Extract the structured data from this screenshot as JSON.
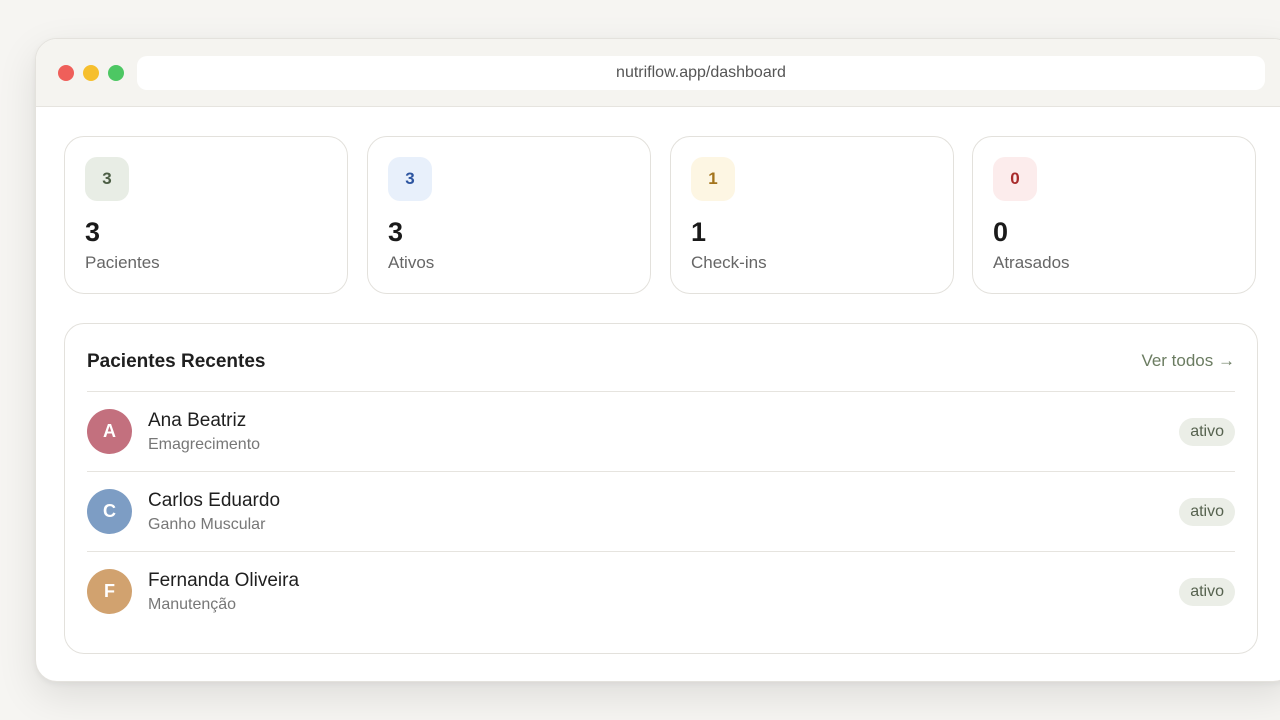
{
  "browser": {
    "url": "nutriflow.app/dashboard"
  },
  "stats": [
    {
      "badge": "3",
      "value": "3",
      "label": "Pacientes",
      "badge_bg": "#e8ede5",
      "badge_color": "#4b5d44"
    },
    {
      "badge": "3",
      "value": "3",
      "label": "Ativos",
      "badge_bg": "#e8f0fb",
      "badge_color": "#2d55a0"
    },
    {
      "badge": "1",
      "value": "1",
      "label": "Check-ins",
      "badge_bg": "#fdf6e3",
      "badge_color": "#a3741c"
    },
    {
      "badge": "0",
      "value": "0",
      "label": "Atrasados",
      "badge_bg": "#fcecec",
      "badge_color": "#a82b2b"
    }
  ],
  "recent": {
    "title": "Pacientes Recentes",
    "see_all": "Ver todos →",
    "patients": [
      {
        "initial": "A",
        "name": "Ana Beatriz",
        "goal": "Emagrecimento",
        "status": "ativo",
        "avatar_color": "#c3707e"
      },
      {
        "initial": "C",
        "name": "Carlos Eduardo",
        "goal": "Ganho Muscular",
        "status": "ativo",
        "avatar_color": "#7d9dc4"
      },
      {
        "initial": "F",
        "name": "Fernanda Oliveira",
        "goal": "Manutenção",
        "status": "ativo",
        "avatar_color": "#d1a26f"
      }
    ]
  }
}
